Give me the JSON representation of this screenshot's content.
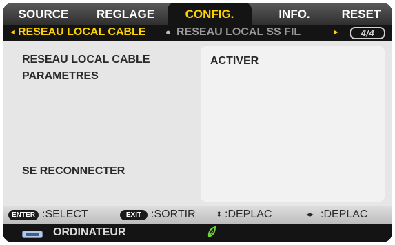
{
  "tabs": [
    {
      "label": "SOURCE",
      "active": false
    },
    {
      "label": "REGLAGE",
      "active": false
    },
    {
      "label": "CONFIG.",
      "active": true
    },
    {
      "label": "INFO.",
      "active": false
    },
    {
      "label": "RESET",
      "active": false
    }
  ],
  "subtabs": {
    "left_arrow": "◄",
    "current": "RESEAU LOCAL CABLE",
    "separator": "●",
    "next": "RESEAU LOCAL SS FIL",
    "right_arrow": "►",
    "page": "4/4"
  },
  "settings": {
    "row1_label": "RESEAU LOCAL CABLE",
    "row1_value": "ACTIVER",
    "row2_label": "PARAMETRES",
    "row3_label": "SE RECONNECTER"
  },
  "helpbar": {
    "enter_key": "ENTER",
    "enter_text": ":SELECT",
    "exit_key": "EXIT",
    "exit_text": ":SORTIR",
    "updown_icon": "⬍",
    "updown_text": ":DEPLAC",
    "leftright_icon": "◂▸",
    "leftright_text": ":DEPLAC"
  },
  "status": {
    "source_icon": "computer-input-icon",
    "source_label": "ORDINATEUR",
    "eco_icon": "leaf-icon"
  },
  "colors": {
    "active_tab_text": "#ffd200",
    "panel_bg": "#e6e6e6",
    "value_box_bg": "#f2f2f2",
    "eco_green": "#6fcf3a"
  }
}
